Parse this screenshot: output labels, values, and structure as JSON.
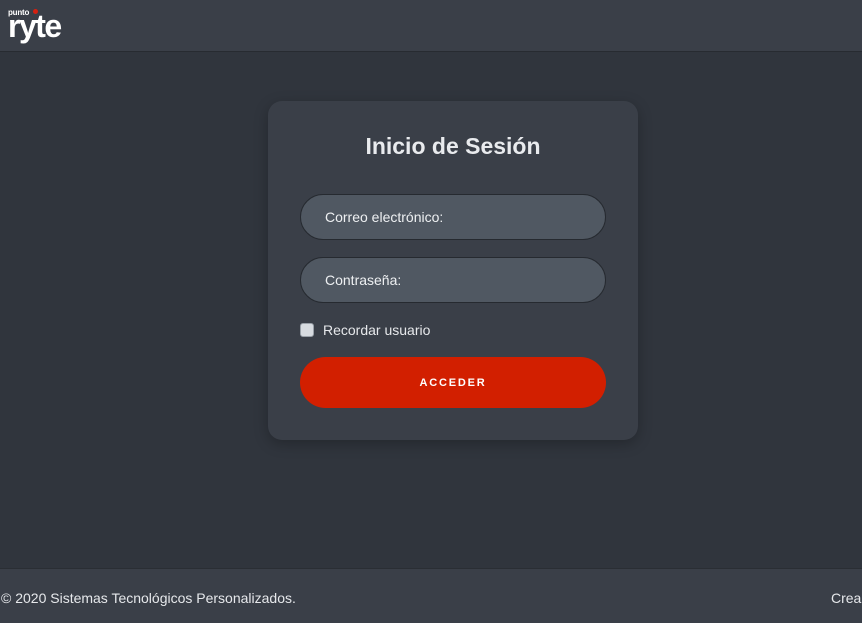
{
  "header": {
    "logo": {
      "small_text": "punto",
      "big_text": "ryte",
      "dot_color": "#d52010"
    }
  },
  "login": {
    "title": "Inicio de Sesión",
    "email_placeholder": "Correo electrónico:",
    "password_placeholder": "Contraseña:",
    "remember_label": "Recordar usuario",
    "remember_checked": false,
    "submit_label": "ACCEDER",
    "submit_color": "#d21f00"
  },
  "footer": {
    "copyright": "© 2020 Sistemas Tecnológicos Personalizados.",
    "credit_visible": "Crea"
  }
}
